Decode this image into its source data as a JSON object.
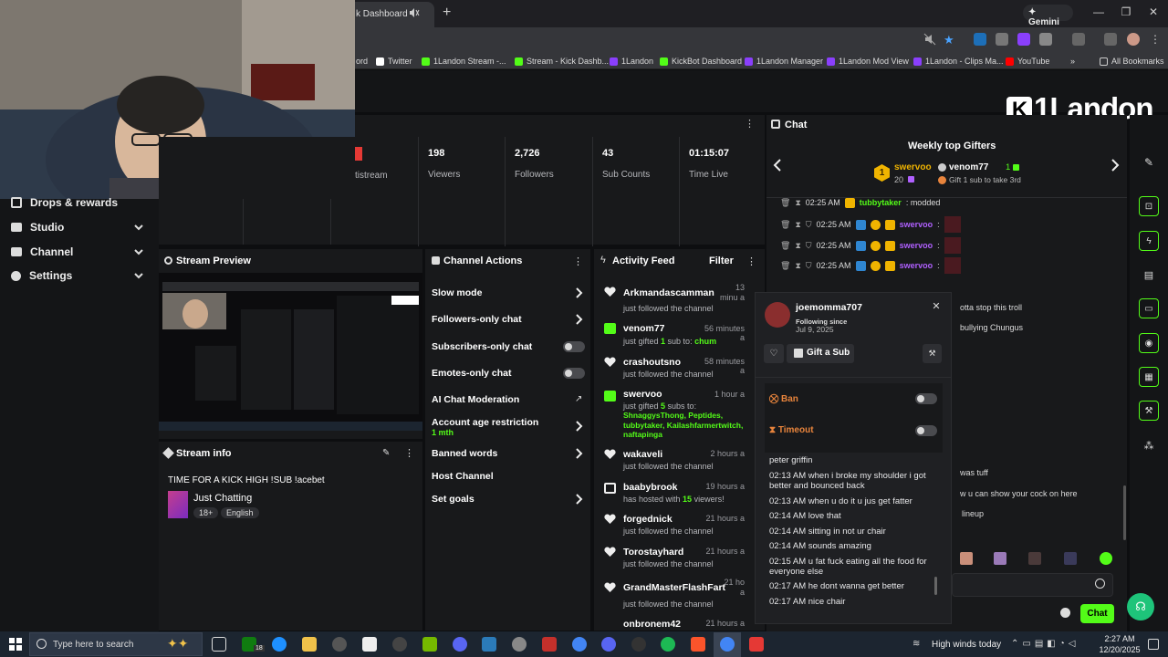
{
  "browser": {
    "tab_title": "k Dashboard",
    "gemini_label": "Gemini",
    "bookmarks": [
      "ord",
      "Twitter",
      "1Landon Stream -...",
      "Stream - Kick Dashb...",
      "1Landon",
      "KickBot Dashboard",
      "1Landon Manager",
      "1Landon Mod View",
      "1Landon - Clips Ma...",
      "YouTube"
    ],
    "all_bookmarks": "All Bookmarks",
    "more": "»"
  },
  "brand": {
    "logo_text": "1Landon",
    "logo_k": "K"
  },
  "nav": {
    "drops": "Drops & rewards",
    "studio": "Studio",
    "channel": "Channel",
    "settings": "Settings"
  },
  "stats": {
    "partial_label": "tistream",
    "viewers": {
      "value": "198",
      "label": "Viewers"
    },
    "followers": {
      "value": "2,726",
      "label": "Followers"
    },
    "subs": {
      "value": "43",
      "label": "Sub Counts"
    },
    "time": {
      "value": "01:15:07",
      "label": "Time Live"
    }
  },
  "preview": {
    "title": "Stream Preview"
  },
  "stream_info": {
    "title": "Stream info",
    "stream_title": "TIME FOR A KICK HIGH !SUB !acebet",
    "category": "Just Chatting",
    "tags": [
      "18+",
      "English"
    ]
  },
  "channel_actions": {
    "title": "Channel Actions",
    "slow_mode": "Slow mode",
    "followers_only": "Followers-only chat",
    "subscribers_only": "Subscribers-only chat",
    "emotes_only": "Emotes-only chat",
    "ai_moderation": "AI Chat Moderation",
    "account_age": "Account age restriction",
    "account_age_value": "1 mth",
    "banned_words": "Banned words",
    "host_channel": "Host Channel",
    "set_goals": "Set goals"
  },
  "activity": {
    "title": "Activity Feed",
    "filter": "Filter",
    "items": [
      {
        "name": "Arkmandascamman",
        "time": "13 minu a",
        "sub": "just followed the channel"
      },
      {
        "name": "venom77",
        "time": "56 minutes a",
        "sub": "just gifted ",
        "count": "1",
        "sub2": " sub to: ",
        "target": "chum"
      },
      {
        "name": "crashoutsno",
        "time": "58 minutes a",
        "sub": "just followed the channel"
      },
      {
        "name": "swervoo",
        "time": "1 hour a",
        "sub": "just gifted ",
        "count": "5",
        "sub2": " subs to:",
        "targets": "ShnaggysThong, Peptides, tubbytaker, Kailashfarmertwitch, naftapinga"
      },
      {
        "name": "wakaveli",
        "time": "2 hours a",
        "sub": "just followed the channel"
      },
      {
        "name": "baabybrook",
        "time": "19 hours a",
        "sub": "has hosted with ",
        "count": "15",
        "sub2": " viewers!"
      },
      {
        "name": "forgednick",
        "time": "21 hours a",
        "sub": "just followed the channel"
      },
      {
        "name": "Torostayhard",
        "time": "21 hours a",
        "sub": "just followed the channel"
      },
      {
        "name": "GrandMasterFlashFart",
        "time": "21 ho a",
        "sub": "just followed the channel"
      },
      {
        "name": "onbronem42",
        "time": "21 hours a",
        "sub": ""
      }
    ]
  },
  "chat": {
    "title": "Chat",
    "gifters_title": "Weekly top Gifters",
    "top1": {
      "name": "swervoo",
      "count": "20",
      "rank": "1"
    },
    "top2": {
      "name": "venom77",
      "count": "1",
      "note": "Gift 1 sub to take 3rd"
    },
    "rows": [
      {
        "time": "02:25 AM",
        "user": "tubbytaker",
        "text": ": modded"
      },
      {
        "time": "02:25 AM",
        "user": "swervoo",
        "text": ":"
      },
      {
        "time": "02:25 AM",
        "user": "swervoo",
        "text": ":"
      },
      {
        "time": "02:25 AM",
        "user": "swervoo",
        "text": ":"
      }
    ],
    "behind_texts": [
      "otta stop this troll",
      "bullying Chungus",
      "was tuff",
      "w u can show your cock on here",
      "lineup"
    ],
    "send_label": "Chat"
  },
  "popup": {
    "username": "joemomma707",
    "following_since": "Following since",
    "follow_date": "Jul 9, 2025",
    "gift_label": "Gift a Sub",
    "ban_label": "Ban",
    "timeout_label": "Timeout",
    "messages": [
      "peter griffin",
      "02:13 AM when i broke my shoulder i got better and bounced back",
      "02:13 AM when u do it u jus get fatter",
      "02:14 AM love that",
      "02:14 AM sitting in not ur chair",
      "02:14 AM sounds amazing",
      "02:15 AM u fat fuck eating all the food for everyone else",
      "02:17 AM he dont wanna get better",
      "02:17 AM nice chair"
    ]
  },
  "taskbar": {
    "search_placeholder": "Type here to search",
    "weather": "High winds today",
    "time": "2:27 AM",
    "date": "12/20/2025",
    "badge": "18"
  },
  "colors": {
    "kick_green": "#53fc18",
    "panel": "#18191b",
    "purple": "#b060ff"
  }
}
